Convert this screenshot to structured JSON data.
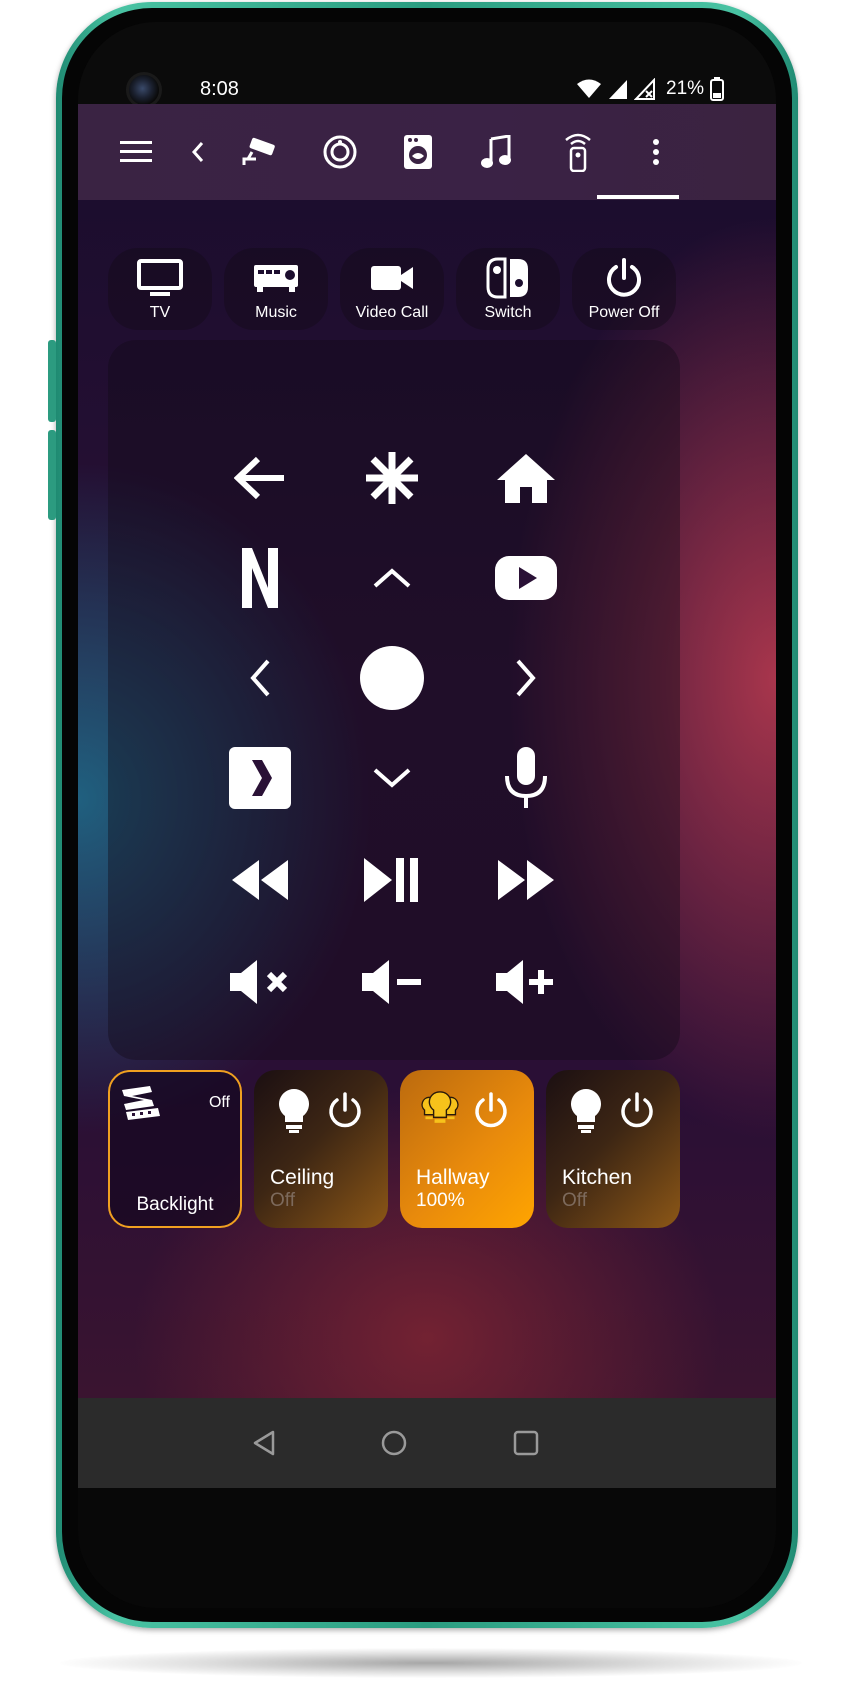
{
  "status_bar": {
    "time": "8:08",
    "battery": "21%",
    "icons": [
      "wifi-icon",
      "signal-icon",
      "no-signal-icon",
      "battery-icon"
    ]
  },
  "app_bar": {
    "icons": [
      "menu-icon",
      "back-icon",
      "security-camera-icon",
      "robot-vacuum-icon",
      "washing-machine-icon",
      "music-note-icon",
      "remote-icon",
      "more-vert-icon"
    ],
    "active_tab": "remote-icon"
  },
  "shortcuts": [
    {
      "label": "TV",
      "icon": "tv-icon"
    },
    {
      "label": "Music",
      "icon": "av-receiver-icon"
    },
    {
      "label": "Video Call",
      "icon": "video-camera-icon"
    },
    {
      "label": "Switch",
      "icon": "nintendo-switch-icon"
    },
    {
      "label": "Power Off",
      "icon": "power-icon"
    }
  ],
  "remote": {
    "buttons": [
      "arrow-back-icon",
      "asterisk-icon",
      "home-icon",
      "netflix-icon",
      "chevron-up-icon",
      "youtube-icon",
      "chevron-left-icon",
      "ok-circle-icon",
      "chevron-right-icon",
      "plex-icon",
      "chevron-down-icon",
      "microphone-icon",
      "rewind-icon",
      "play-pause-icon",
      "fast-forward-icon",
      "volume-mute-icon",
      "volume-down-icon",
      "volume-up-icon"
    ]
  },
  "tiles": {
    "backlight": {
      "name": "Backlight",
      "state": "Off",
      "icon": "led-strip-icon",
      "border_color": "#f0a020"
    },
    "lights": [
      {
        "name": "Ceiling",
        "state": "Off",
        "on": false,
        "icon": "lightbulb-icon"
      },
      {
        "name": "Hallway",
        "state": "100%",
        "on": true,
        "icon": "lightbulb-group-icon"
      },
      {
        "name": "Kitchen",
        "state": "Off",
        "on": false,
        "icon": "lightbulb-icon"
      }
    ]
  },
  "nav_bar": {
    "icons": [
      "nav-back-icon",
      "nav-home-icon",
      "nav-recents-icon"
    ]
  },
  "colors": {
    "frame": "#2a9c80",
    "accent_on": "#ffa500",
    "hallway_bulb": "#f7c21b",
    "app_bar": "#3a2343"
  }
}
